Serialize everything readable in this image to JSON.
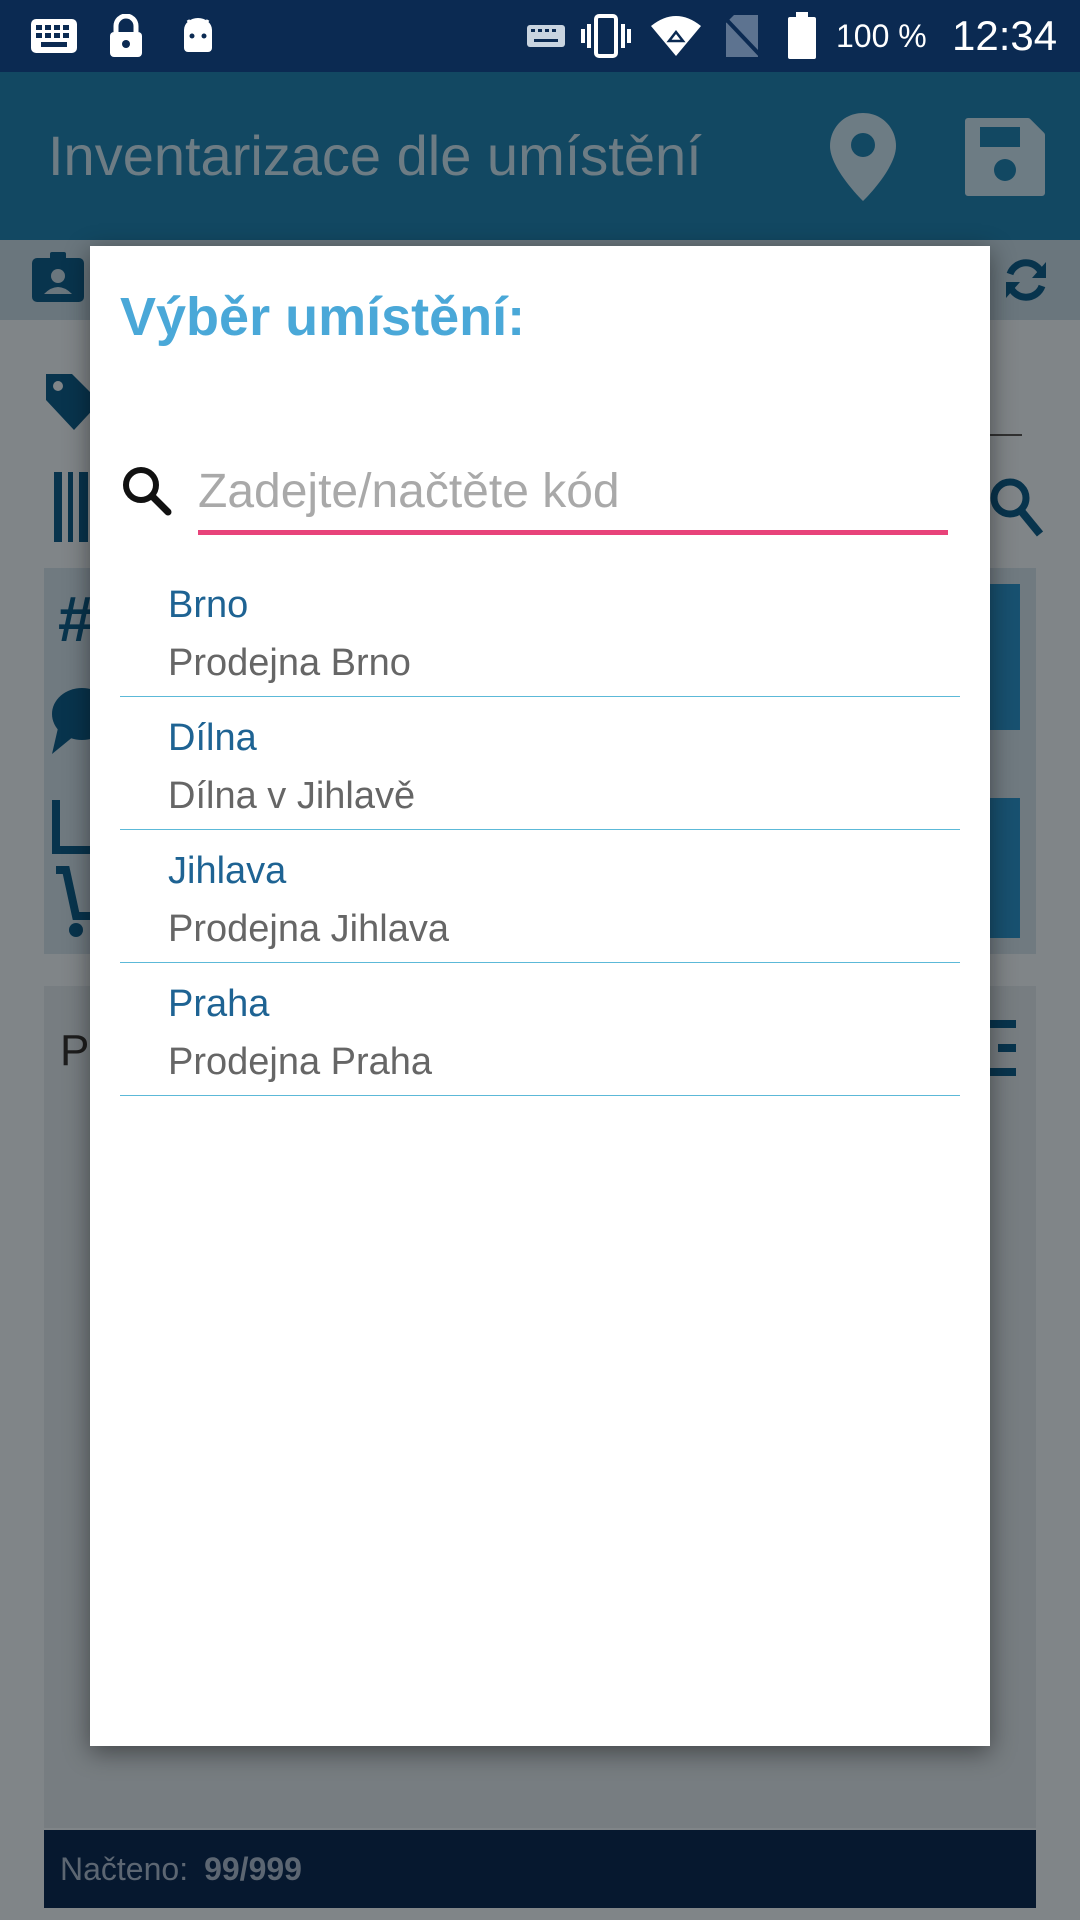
{
  "status_bar": {
    "battery_percent": "100 %",
    "time": "12:34",
    "icons": [
      "keyboard-icon",
      "lock-icon",
      "android-icon",
      "keyboard-small-icon",
      "vibrate-icon",
      "wifi-icon",
      "no-sim-icon",
      "battery-icon"
    ]
  },
  "app_bar": {
    "title": "Inventarizace dle umístění",
    "icons": [
      "location-pin-icon",
      "save-icon"
    ]
  },
  "background": {
    "partial_label": "P",
    "footer_label": "Načteno:",
    "footer_value": "99/999"
  },
  "dialog": {
    "title": "Výběr umístění:",
    "search_placeholder": "Zadejte/načtěte kód",
    "search_value": "",
    "items": [
      {
        "code": "Brno",
        "name": "Prodejna Brno"
      },
      {
        "code": "Dílna",
        "name": "Dílna v Jihlavě"
      },
      {
        "code": "Jihlava",
        "name": "Prodejna Jihlava"
      },
      {
        "code": "Praha",
        "name": "Prodejna Praha"
      }
    ]
  },
  "colors": {
    "status_bar": "#0b2a52",
    "app_bar": "#1f7ca9",
    "dialog_title": "#4aa8d8",
    "input_underline": "#e8437a",
    "item_code": "#1e6393",
    "divider": "#5cb9d8"
  }
}
